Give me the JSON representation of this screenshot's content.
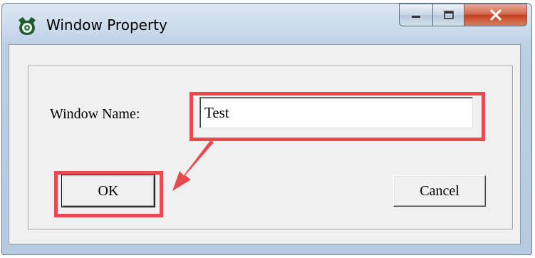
{
  "window": {
    "title": "Window Property",
    "app_icon": "robot-owl-icon",
    "caption_buttons": [
      "minimize-icon",
      "maximize-icon",
      "close-icon"
    ]
  },
  "form": {
    "name_label": "Window Name:",
    "name_value": "Test"
  },
  "buttons": {
    "ok_label": "OK",
    "cancel_label": "Cancel"
  },
  "annotation": {
    "highlight_color": "#e84a4f"
  }
}
